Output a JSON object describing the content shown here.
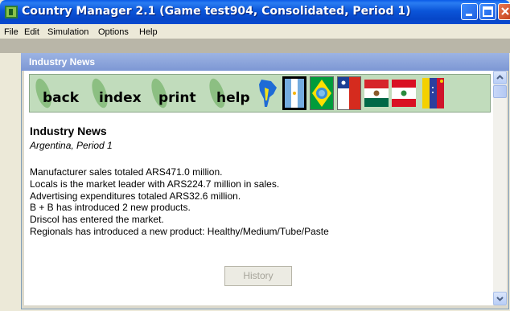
{
  "window": {
    "title": "Country Manager 2.1 (Game test904, Consolidated, Period 1)"
  },
  "menu": {
    "items": [
      {
        "label": "File"
      },
      {
        "label": "Edit"
      },
      {
        "label": "Simulation"
      },
      {
        "label": "Options"
      },
      {
        "label": "Help"
      }
    ]
  },
  "inner_window": {
    "title": "Industry News"
  },
  "nav": {
    "buttons": [
      {
        "label": "back"
      },
      {
        "label": "index"
      },
      {
        "label": "print"
      },
      {
        "label": "help"
      }
    ],
    "icons": [
      "south-america-map-icon",
      "argentina-flag-icon",
      "brazil-flag-icon",
      "chile-flag-icon",
      "mexico-flag-icon",
      "peru-flag-icon",
      "venezuela-flag-icon"
    ]
  },
  "report": {
    "heading": "Industry News",
    "subheading": "Argentina, Period 1",
    "lines": [
      "Manufacturer sales totaled ARS471.0 million.",
      "Locals is the market leader with ARS224.7 million in sales.",
      "Advertising expenditures totaled ARS32.6 million.",
      "B + B has introduced 2 new products.",
      "Driscol has entered the market.",
      "Regionals has introduced a new product: Healthy/Medium/Tube/Paste"
    ]
  },
  "history_button": {
    "label": "History"
  },
  "colors": {
    "titlebar": "#0a4bd0",
    "nav_background": "#c1dcbc",
    "inner_title": "#7d97d4"
  }
}
